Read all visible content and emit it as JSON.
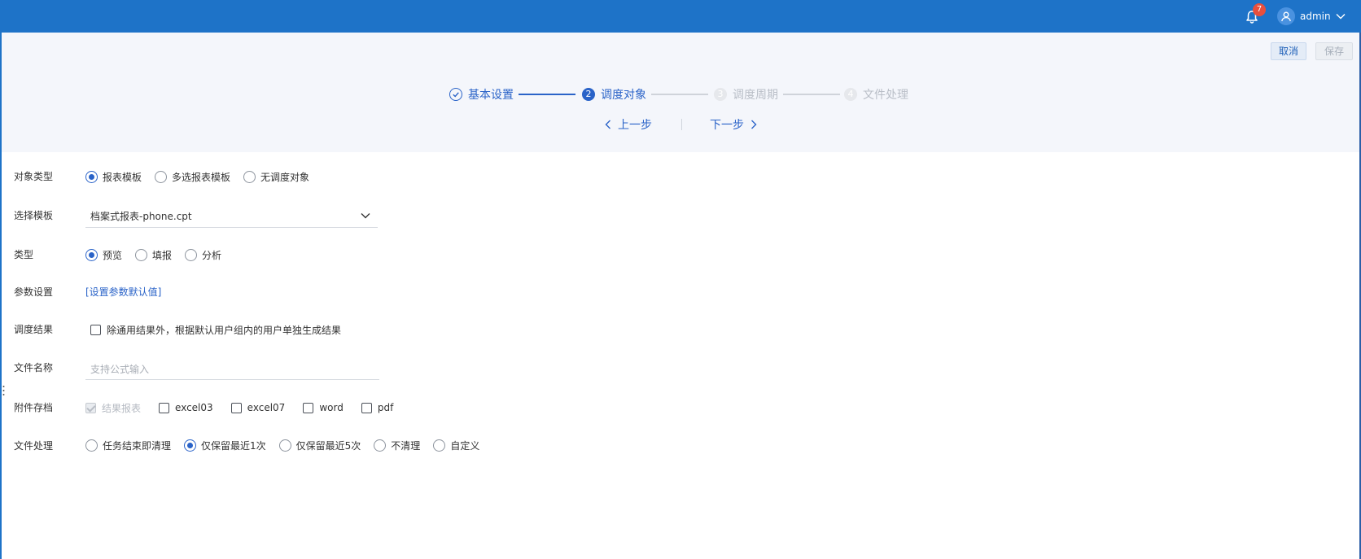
{
  "header": {
    "notification_count": "7",
    "username": "admin"
  },
  "actions": {
    "cancel": "取消",
    "save": "保存"
  },
  "steps": [
    {
      "number": "1",
      "label": "基本设置",
      "state": "done"
    },
    {
      "number": "2",
      "label": "调度对象",
      "state": "active"
    },
    {
      "number": "3",
      "label": "调度周期",
      "state": "pending"
    },
    {
      "number": "4",
      "label": "文件处理",
      "state": "pending"
    }
  ],
  "nav": {
    "prev": "上一步",
    "next": "下一步"
  },
  "form": {
    "object_type": {
      "label": "对象类型",
      "options": [
        "报表模板",
        "多选报表模板",
        "无调度对象"
      ],
      "selected": "报表模板"
    },
    "template": {
      "label": "选择模板",
      "value": "档案式报表-phone.cpt"
    },
    "type": {
      "label": "类型",
      "options": [
        "预览",
        "填报",
        "分析"
      ],
      "selected": "预览"
    },
    "params": {
      "label": "参数设置",
      "link": "[设置参数默认值]"
    },
    "result": {
      "label": "调度结果",
      "checkbox_label": "除通用结果外，根据默认用户组内的用户单独生成结果",
      "checked": false
    },
    "file_name": {
      "label": "文件名称",
      "placeholder": "支持公式输入",
      "value": ""
    },
    "attachments": {
      "label": "附件存档",
      "options": [
        {
          "label": "结果报表",
          "checked": true,
          "disabled": true
        },
        {
          "label": "excel03",
          "checked": false,
          "disabled": false
        },
        {
          "label": "excel07",
          "checked": false,
          "disabled": false
        },
        {
          "label": "word",
          "checked": false,
          "disabled": false
        },
        {
          "label": "pdf",
          "checked": false,
          "disabled": false
        }
      ]
    },
    "file_handling": {
      "label": "文件处理",
      "options": [
        "任务结束即清理",
        "仅保留最近1次",
        "仅保留最近5次",
        "不清理",
        "自定义"
      ],
      "selected": "仅保留最近1次"
    }
  },
  "colors": {
    "topbar": "#1e73c8",
    "accent": "#2a63c8",
    "badge": "#e84f3d"
  }
}
